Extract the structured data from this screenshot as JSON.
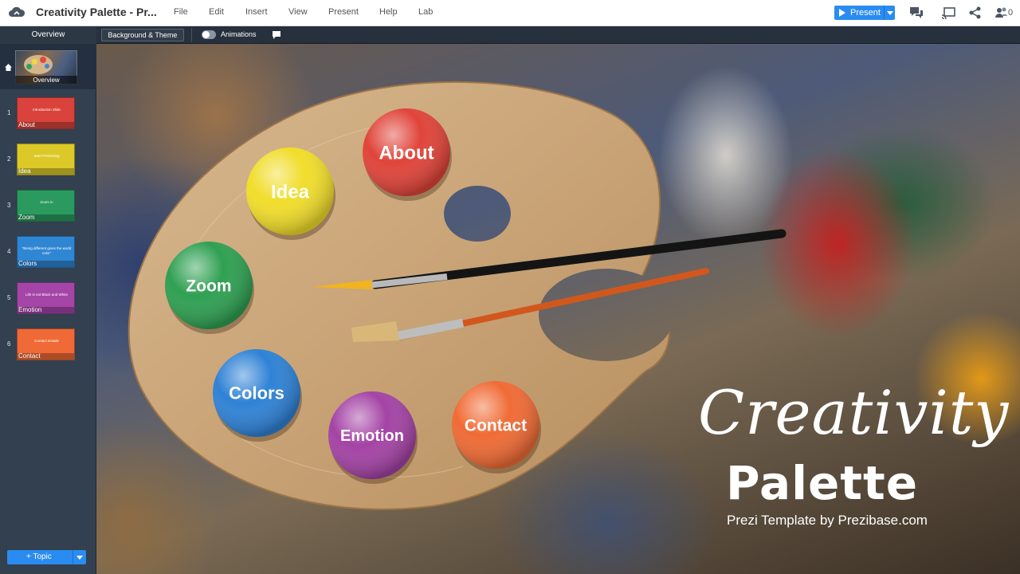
{
  "app": {
    "title": "Creativity Palette - Pr..."
  },
  "menu": [
    "File",
    "Edit",
    "Insert",
    "View",
    "Present",
    "Help",
    "Lab"
  ],
  "header": {
    "present_label": "Present",
    "collaborator_count": "0"
  },
  "toolbar": {
    "overview_label": "Overview",
    "background_theme_label": "Background & Theme",
    "animations_label": "Animations",
    "animations_enabled": false
  },
  "sidebar": {
    "overview_label": "Overview",
    "slides": [
      {
        "num": "1",
        "name": "About",
        "caption": "Introduction Slide",
        "color": "#d9433b"
      },
      {
        "num": "2",
        "name": "Idea",
        "caption": "Start Presenting",
        "color": "#dcc927"
      },
      {
        "num": "3",
        "name": "Zoom",
        "caption": "Zoom in",
        "color": "#2a9a5e"
      },
      {
        "num": "4",
        "name": "Colors",
        "caption": "\"Being different gives the world color\"",
        "color": "#2f86d3"
      },
      {
        "num": "5",
        "name": "Emotion",
        "caption": "Life is not Black and White",
        "color": "#a545a8"
      },
      {
        "num": "6",
        "name": "Contact",
        "caption": "Contact Details",
        "color": "#ef6a36"
      }
    ],
    "add_topic_label": "+ Topic"
  },
  "canvas": {
    "title_script": "Creativity",
    "title_main": "Palette",
    "subtitle": "Prezi Template by Prezibase.com",
    "buttons": [
      {
        "label": "About",
        "color": "#e0443a"
      },
      {
        "label": "Idea",
        "color": "#f1dd2b"
      },
      {
        "label": "Zoom",
        "color": "#2fa052"
      },
      {
        "label": "Colors",
        "color": "#2f82d6"
      },
      {
        "label": "Emotion",
        "color": "#a443a5"
      },
      {
        "label": "Contact",
        "color": "#f06b35"
      }
    ]
  },
  "colors": {
    "accent": "#2a8cf0",
    "sidebar_bg": "#324050",
    "toolbar_bg": "#27313d"
  }
}
